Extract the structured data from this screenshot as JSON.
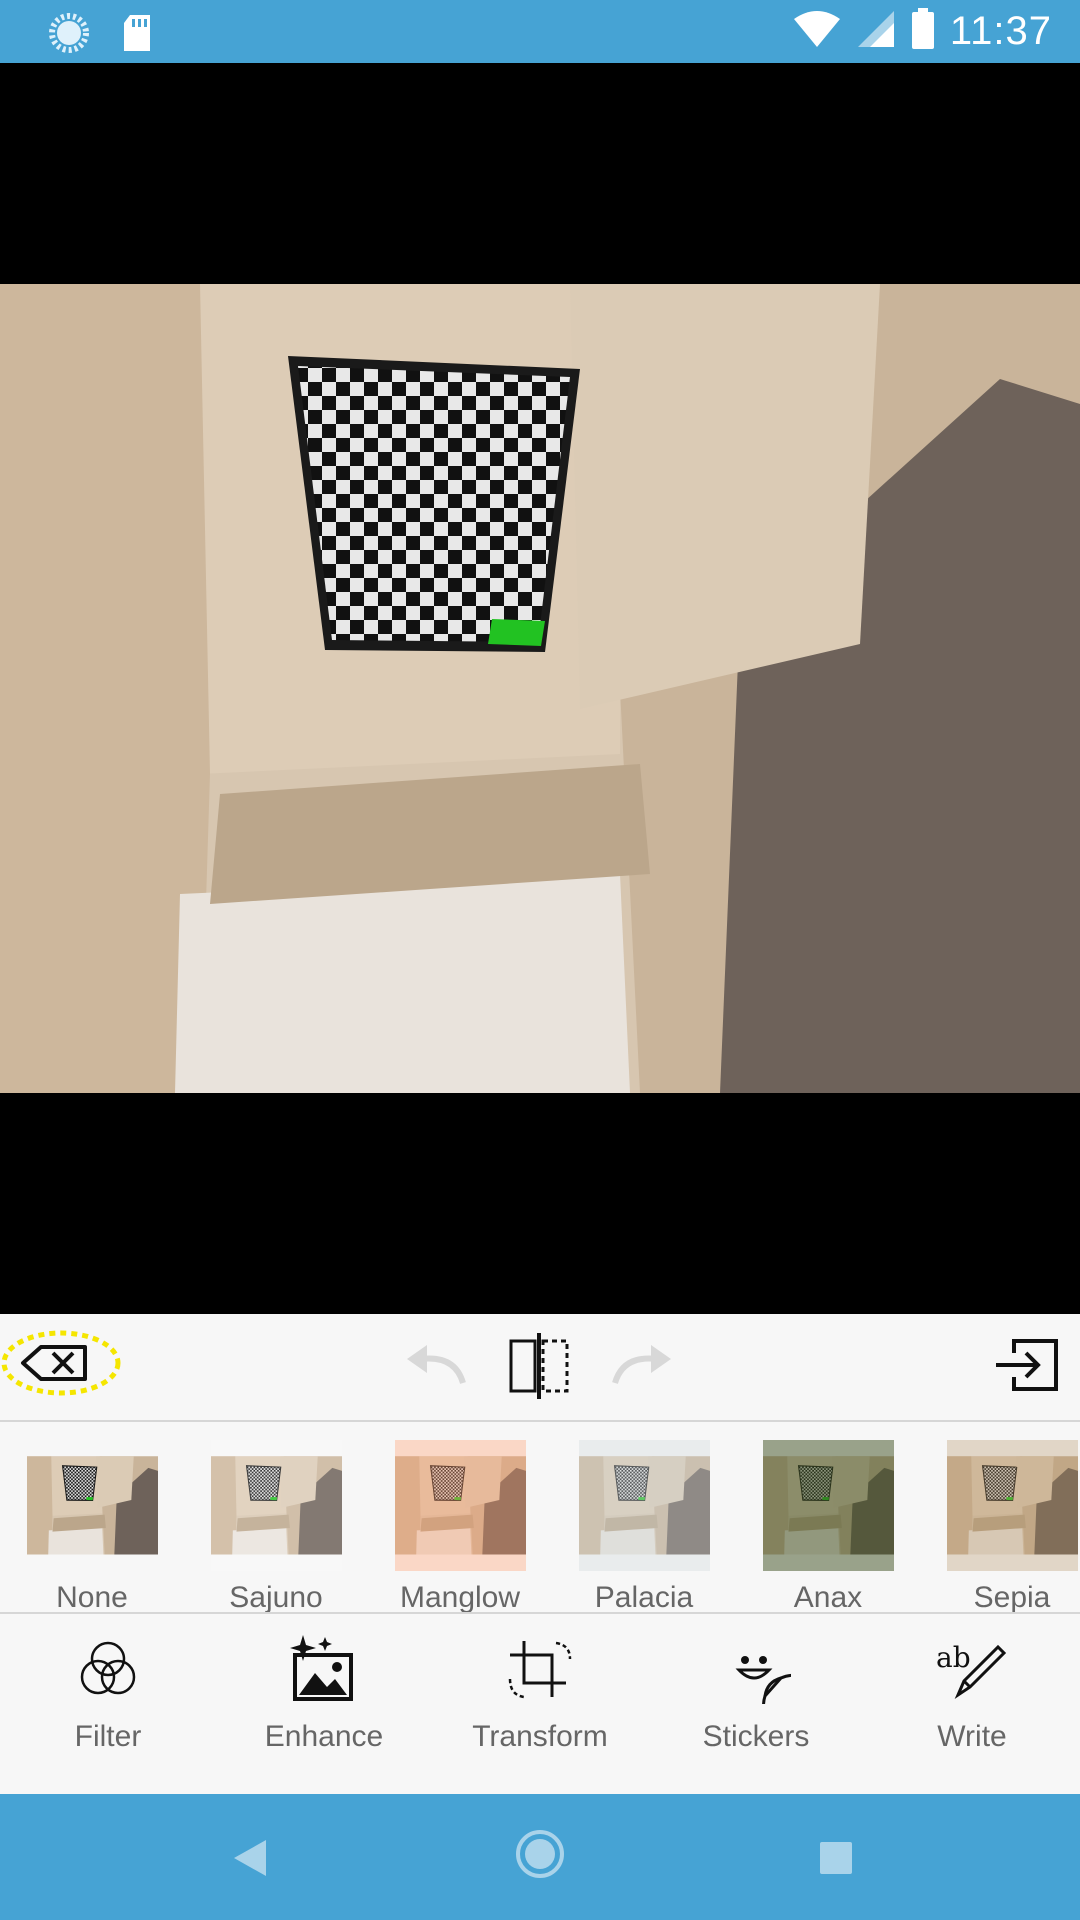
{
  "status_bar": {
    "time": "11:37"
  },
  "filters": [
    {
      "label": "None",
      "tint": "#000000",
      "tint_opacity": 0
    },
    {
      "label": "Sajuno",
      "tint": "#ffffff",
      "tint_opacity": 0.15
    },
    {
      "label": "Manglow",
      "tint": "#ff9a6b",
      "tint_opacity": 0.35
    },
    {
      "label": "Palacia",
      "tint": "#cfd6d9",
      "tint_opacity": 0.35
    },
    {
      "label": "Anax",
      "tint": "#3b4d1e",
      "tint_opacity": 0.5
    },
    {
      "label": "Sepia",
      "tint": "#b08a5a",
      "tint_opacity": 0.3
    }
  ],
  "tools": [
    {
      "label": "Filter",
      "icon": "filter-circles-icon"
    },
    {
      "label": "Enhance",
      "icon": "enhance-image-icon"
    },
    {
      "label": "Transform",
      "icon": "crop-rotate-icon"
    },
    {
      "label": "Stickers",
      "icon": "sticker-smiley-icon"
    },
    {
      "label": "Write",
      "icon": "write-pen-icon"
    }
  ],
  "colors": {
    "accent": "#46a3d4",
    "panel": "#f7f7f7"
  }
}
